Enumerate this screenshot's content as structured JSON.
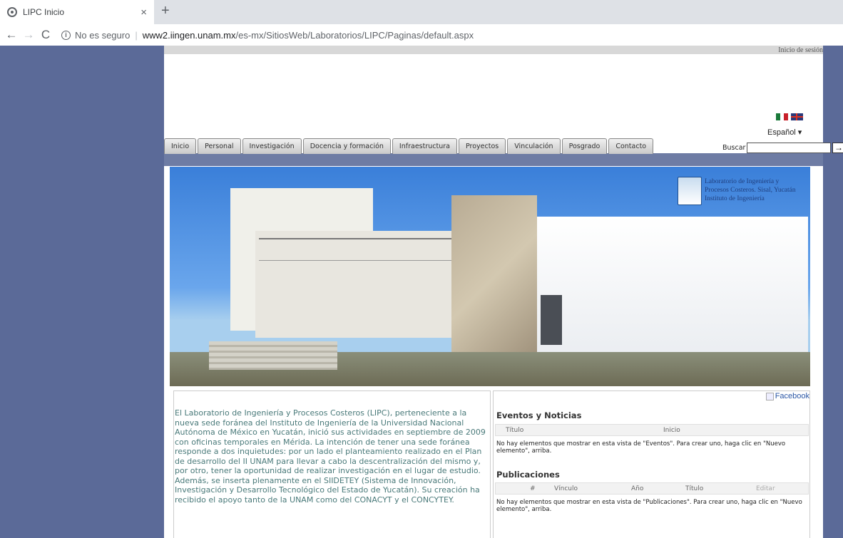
{
  "browser": {
    "tab_title": "LIPC Inicio",
    "tab_close": "×",
    "new_tab": "+",
    "back": "←",
    "forward": "→",
    "reload": "C",
    "security_label": "No es seguro",
    "url_host": "www2.iingen.unam.mx",
    "url_path": "/es-mx/SitiosWeb/Laboratorios/LIPC/Paginas/default.aspx"
  },
  "header": {
    "signin": "Inicio de sesión",
    "language": "Español ▾"
  },
  "nav": {
    "tabs": [
      "Inicio",
      "Personal",
      "Investigación",
      "Docencia y formación",
      "Infraestructura",
      "Proyectos",
      "Vinculación",
      "Posgrado",
      "Contacto"
    ],
    "search_label": "Buscar",
    "search_go": "→"
  },
  "hero": {
    "logo_line1": "Laboratorio de Ingeniería y",
    "logo_line2": "Procesos Costeros. Sisal, Yucatán",
    "logo_line3": "Instituto de Ingeniería"
  },
  "intro": {
    "text": "El Laboratorio de Ingeniería y Procesos Costeros (LIPC), perteneciente a la nueva sede foránea del Instituto de Ingeniería de la Universidad Nacional Autónoma de México en Yucatán, inició sus actividades en septiembre de 2009 con oficinas temporales en Mérida. La intención de tener una sede foránea  responde a dos inquietudes: por un lado el planteamiento realizado en el Plan de desarrollo del II UNAM para llevar a cabo la descentralización del mismo y, por otro, tener la oportunidad de realizar investigación en el lugar de estudio. Además, se inserta plenamente en el SIIDETEY (Sistema de Innovación, Investigación y Desarrollo Tecnológico del Estado de Yucatán). Su creación ha recibido el apoyo tanto de la UNAM como del CONACYT y el CONCYTEY."
  },
  "sidebar": {
    "facebook": "Facebook",
    "events": {
      "title": "Eventos y Noticias",
      "col_title": "Título",
      "col_start": "Inicio",
      "empty": "No hay elementos que mostrar en esta vista de \"Eventos\". Para crear uno, haga clic en \"Nuevo elemento\", arriba."
    },
    "publications": {
      "title": "Publicaciones",
      "col_num": "#",
      "col_link": "Vínculo",
      "col_year": "Año",
      "col_title": "Título",
      "col_edit": "Editar",
      "empty": "No hay elementos que mostrar en esta vista de \"Publicaciones\". Para crear uno, haga clic en \"Nuevo elemento\", arriba."
    }
  }
}
